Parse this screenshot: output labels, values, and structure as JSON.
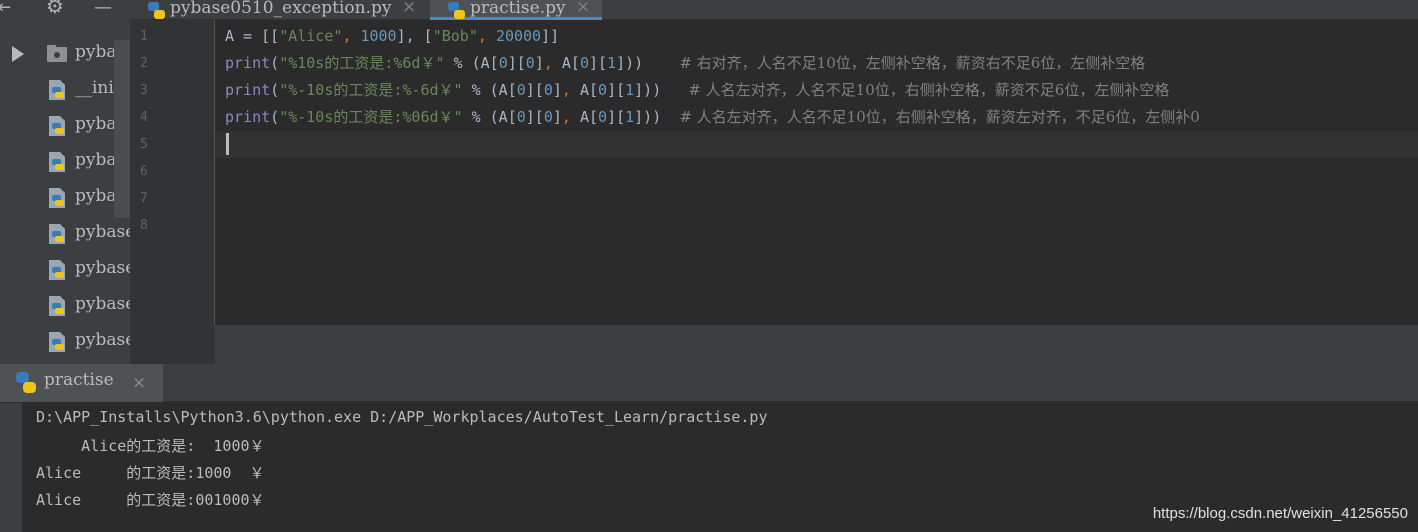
{
  "editor": {
    "tabs": [
      {
        "label": "pybase0510_exception.py",
        "active": false
      },
      {
        "label": "practise.py",
        "active": true
      }
    ],
    "line_numbers": [
      "1",
      "2",
      "3",
      "4",
      "5",
      "6",
      "7",
      "8"
    ],
    "code": {
      "line1": {
        "a": "A = [[",
        "s1": "\"Alice\"",
        "c1": ", ",
        "n1": "1000",
        "b1": "], [",
        "s2": "\"Bob\"",
        "c2": ", ",
        "n2": "20000",
        "b2": "]]"
      },
      "line2": {
        "kw": "print",
        "p1": "(",
        "str": "\"%10s的工资是:%6d￥\"",
        "rest1": " % (A[",
        "i1": "0",
        "r2": "][",
        "i2": "0",
        "r3": "]",
        "comma": ", ",
        "r4": "A[",
        "i3": "0",
        "r5": "][",
        "i4": "1",
        "r6": "]))",
        "comment": "# 右对齐，人名不足10位，左侧补空格，薪资右不足6位，左侧补空格"
      },
      "line3": {
        "kw": "print",
        "p1": "(",
        "str": "\"%-10s的工资是:%-6d￥\"",
        "rest1": " % (A[",
        "i1": "0",
        "r2": "][",
        "i2": "0",
        "r3": "]",
        "comma": ", ",
        "r4": "A[",
        "i3": "0",
        "r5": "][",
        "i4": "1",
        "r6": "]))",
        "comment": "# 人名左对齐，人名不足10位，右侧补空格，薪资不足6位，左侧补空格"
      },
      "line4": {
        "kw": "print",
        "p1": "(",
        "str": "\"%-10s的工资是:%06d￥\"",
        "rest1": " % (A[",
        "i1": "0",
        "r2": "][",
        "i2": "0",
        "r3": "]",
        "comma": ", ",
        "r4": "A[",
        "i3": "0",
        "r5": "][",
        "i4": "1",
        "r6": "]))",
        "comment": "# 人名左对齐，人名不足10位，右侧补空格，薪资左对齐，不足6位，左侧补0"
      }
    }
  },
  "sidebar": {
    "items": [
      {
        "label": "pybase",
        "type": "folder"
      },
      {
        "label": "__init_",
        "type": "py"
      },
      {
        "label": "pybase",
        "type": "py"
      },
      {
        "label": "pybase",
        "type": "py"
      },
      {
        "label": "pybase",
        "type": "py"
      },
      {
        "label": "pybase",
        "type": "py"
      },
      {
        "label": "pybase",
        "type": "py"
      },
      {
        "label": "pybase",
        "type": "py"
      },
      {
        "label": "pybase",
        "type": "py"
      }
    ],
    "toolbar": {
      "collapse": "⇤",
      "settings": "⚙",
      "minimize": "—"
    }
  },
  "run": {
    "tab_label": "practise",
    "close": "×",
    "output": [
      "D:\\APP_Installs\\Python3.6\\python.exe D:/APP_Workplaces/AutoTest_Learn/practise.py",
      "     Alice的工资是:  1000￥",
      "Alice     的工资是:1000  ￥",
      "Alice     的工资是:001000￥"
    ]
  },
  "watermark": "https://blog.csdn.net/weixin_41256550",
  "colors": {
    "background": "#2b2b2b",
    "panel": "#3c3f41",
    "keyword": "#8888c6",
    "string": "#6a8759",
    "number": "#6897bb",
    "punctuation": "#cc7832",
    "comment": "#808080",
    "active_tab_underline": "#4a88c7"
  }
}
